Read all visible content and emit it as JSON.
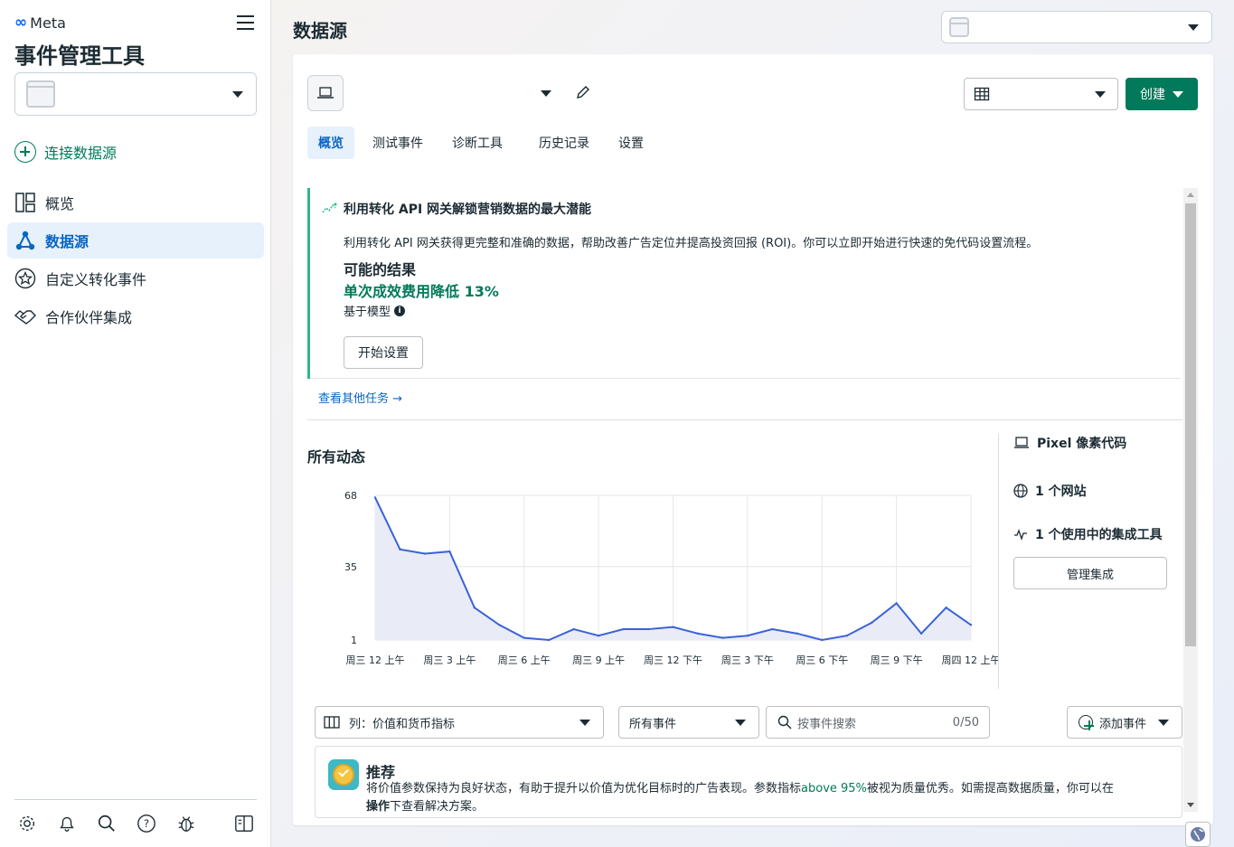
{
  "sidebar": {
    "brand": "Meta",
    "app_title": "事件管理工具",
    "connect_label": "连接数据源",
    "nav": [
      {
        "label": "概览",
        "icon": "overview-icon"
      },
      {
        "label": "数据源",
        "icon": "data-source-icon"
      },
      {
        "label": "自定义转化事件",
        "icon": "star-icon"
      },
      {
        "label": "合作伙伴集成",
        "icon": "handshake-icon"
      }
    ],
    "active_nav": "数据源",
    "footer_icons": [
      "gear-icon",
      "bell-icon",
      "search-icon",
      "help-icon",
      "bug-icon",
      "panel-toggle-icon"
    ]
  },
  "header": {
    "page_title": "数据源"
  },
  "card": {
    "create_label": "创建",
    "tabs": [
      "概览",
      "测试事件",
      "诊断工具",
      "历史记录",
      "设置"
    ],
    "active_tab": "概览",
    "promo": {
      "title": "利用转化 API 网关解锁营销数据的最大潜能",
      "description": "利用转化 API 网关获得更完整和准确的数据，帮助改善广告定位并提高投资回报 (ROI)。你可以立即开始进行快速的免代码设置流程。",
      "results_heading": "可能的结果",
      "result_value": "单次成效费用降低 13%",
      "model_note": "基于模型",
      "cta": "开始设置"
    },
    "more_tasks": "查看其他任务 →",
    "activity_title": "所有动态",
    "stats": {
      "pixel": "Pixel 像素代码",
      "websites": "1 个网站",
      "integrations": "1 个使用中的集成工具",
      "manage": "管理集成"
    },
    "filters": {
      "columns": "列：价值和货币指标",
      "events": "所有事件",
      "search_placeholder": "按事件搜索",
      "search_count": "0/50",
      "add_event": "添加事件"
    },
    "recommendation": {
      "title": "推荐",
      "text_before": "将价值参数保持为良好状态，有助于提升以价值为优化目标时的广告表现。参数指标",
      "highlight": "above 95%",
      "text_after": "被视为质量优秀。如需提高数据质量，你可以在",
      "bold_tail": "操作",
      "text_end": "下查看解决方案。"
    }
  },
  "chart_data": {
    "type": "area",
    "title": "所有动态",
    "y_ticks": [
      68,
      35,
      1
    ],
    "ylim": [
      1,
      68
    ],
    "x_tick_labels": [
      "周三 12 上午",
      "周三 3 上午",
      "周三 6 上午",
      "周三 9 上午",
      "周三 12 下午",
      "周三 3 下午",
      "周三 6 下午",
      "周三 9 下午",
      "周四 12 上午"
    ],
    "series": [
      {
        "values": [
          67,
          43,
          41,
          42,
          16,
          8,
          2,
          1,
          6,
          3,
          6,
          6,
          7,
          4,
          2,
          3,
          6,
          4,
          1,
          3,
          9,
          18,
          4,
          16,
          8
        ]
      }
    ],
    "colors": {
      "line": "#3b63d6",
      "fill": "#e9ecf7"
    }
  }
}
